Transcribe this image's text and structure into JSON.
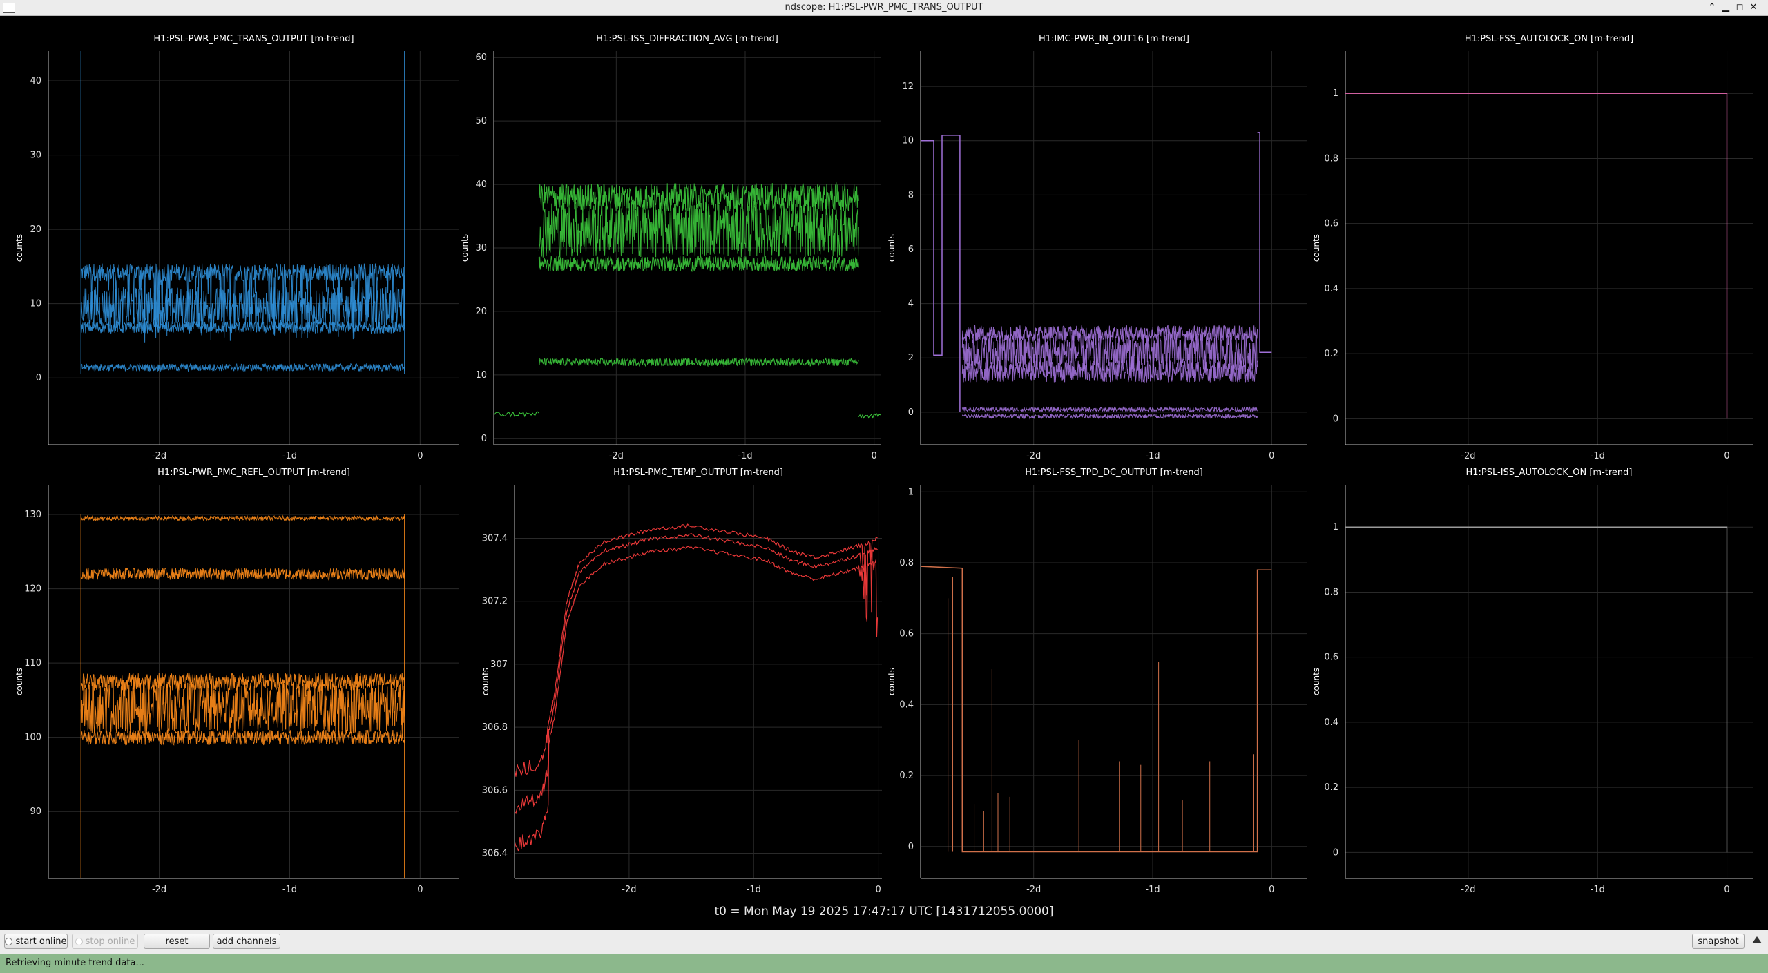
{
  "window": {
    "title": "ndscope: H1:PSL-PWR_PMC_TRANS_OUTPUT"
  },
  "colors": {
    "blue": "#2f8fd8",
    "green": "#3cc83c",
    "purple": "#a070d8",
    "pink": "#d060a0",
    "orange": "#ff8c1a",
    "red": "#e83838",
    "brown": "#d0704a",
    "gray": "#9a9a9a"
  },
  "t0_label": "t0 = Mon May 19 2025 17:47:17 UTC [1431712055.0000]",
  "toolbar": {
    "start_online": "start online",
    "stop_online": "stop online",
    "reset": "reset",
    "add_channels": "add channels",
    "snapshot": "snapshot"
  },
  "status": {
    "message": "Retrieving minute trend data..."
  },
  "chart_data": [
    {
      "type": "line",
      "title": "H1:PSL-PWR_PMC_TRANS_OUTPUT [m-trend]",
      "ylabel": "counts",
      "color": "blue",
      "xlim": [
        -2.85,
        0.3
      ],
      "ylim": [
        -9,
        44
      ],
      "x_ticks": [
        {
          "v": -2,
          "label": "-2d"
        },
        {
          "v": -1,
          "label": "-1d"
        },
        {
          "v": 0,
          "label": "0"
        }
      ],
      "y_ticks": [
        0,
        10,
        20,
        30,
        40
      ],
      "data_start": -2.6,
      "data_end": -0.12,
      "series": [
        {
          "name": "max",
          "level": 14.2,
          "noise": 1.2,
          "dips": 9.5,
          "dip_prob": 0.12
        },
        {
          "name": "mean",
          "level": 9.5,
          "noise": 2.8
        },
        {
          "name": "min",
          "level": 6.8,
          "noise": 0.8
        },
        {
          "name": "min-low",
          "level": 1.4,
          "noise": 0.5
        }
      ],
      "edge_spike": {
        "low": 0.5,
        "high": 45
      }
    },
    {
      "type": "line",
      "title": "H1:PSL-ISS_DIFFRACTION_AVG [m-trend]",
      "ylabel": "counts",
      "color": "green",
      "xlim": [
        -2.95,
        0.05
      ],
      "ylim": [
        -1,
        61
      ],
      "x_ticks": [
        {
          "v": -2,
          "label": "-2d"
        },
        {
          "v": -1,
          "label": "-1d"
        },
        {
          "v": 0,
          "label": "0"
        }
      ],
      "y_ticks": [
        0,
        10,
        20,
        30,
        40,
        50,
        60
      ],
      "data_start": -2.6,
      "data_end": -0.12,
      "pre_level": 3.8,
      "post_level": 3.5,
      "series": [
        {
          "name": "max",
          "level": 38,
          "noise": 2.2
        },
        {
          "name": "mean",
          "level": 33,
          "noise": 4.5
        },
        {
          "name": "min",
          "level": 27.5,
          "noise": 1.2
        },
        {
          "name": "low",
          "level": 12,
          "noise": 0.6
        }
      ]
    },
    {
      "type": "line",
      "title": "H1:IMC-PWR_IN_OUT16 [m-trend]",
      "ylabel": "counts",
      "color": "purple",
      "xlim": [
        -2.95,
        0.3
      ],
      "ylim": [
        -1.2,
        13.3
      ],
      "x_ticks": [
        {
          "v": -2,
          "label": "-2d"
        },
        {
          "v": -1,
          "label": "-1d"
        },
        {
          "v": 0,
          "label": "0"
        }
      ],
      "y_ticks": [
        0,
        2,
        4,
        6,
        8,
        10,
        12
      ],
      "data_start": -2.6,
      "data_end": -0.12,
      "steps": [
        [
          -2.95,
          10
        ],
        [
          -2.84,
          10
        ],
        [
          -2.84,
          2.1
        ],
        [
          -2.77,
          2.1
        ],
        [
          -2.77,
          10.2
        ],
        [
          -2.62,
          10.2
        ],
        [
          -2.62,
          0
        ]
      ],
      "post_steps": [
        [
          -0.12,
          10.3
        ],
        [
          -0.1,
          10.3
        ],
        [
          -0.1,
          2.2
        ],
        [
          0.0,
          2.2
        ]
      ],
      "series": [
        {
          "name": "max",
          "level": 2.9,
          "noise": 0.3
        },
        {
          "name": "mean",
          "level": 2.2,
          "noise": 0.7
        },
        {
          "name": "min",
          "level": 1.5,
          "noise": 0.4
        },
        {
          "name": "low",
          "level": 0.1,
          "noise": 0.08
        },
        {
          "name": "lowmin",
          "level": -0.15,
          "noise": 0.08
        }
      ]
    },
    {
      "type": "line",
      "title": "H1:PSL-FSS_AUTOLOCK_ON [m-trend]",
      "ylabel": "counts",
      "color": "pink",
      "xlim": [
        -2.95,
        0.2
      ],
      "ylim": [
        -0.08,
        1.13
      ],
      "x_ticks": [
        {
          "v": -2,
          "label": "-2d"
        },
        {
          "v": -1,
          "label": "-1d"
        },
        {
          "v": 0,
          "label": "0"
        }
      ],
      "y_ticks": [
        {
          "v": 0,
          "label": "0"
        },
        {
          "v": 0.2,
          "label": "0.2"
        },
        {
          "v": 0.4,
          "label": "0.4"
        },
        {
          "v": 0.6,
          "label": "0.6"
        },
        {
          "v": 0.8,
          "label": "0.8"
        },
        {
          "v": 1,
          "label": "1"
        }
      ],
      "steps": [
        [
          -2.95,
          1
        ],
        [
          0.0,
          1
        ],
        [
          0.0,
          0
        ]
      ]
    },
    {
      "type": "line",
      "title": "H1:PSL-PWR_PMC_REFL_OUTPUT [m-trend]",
      "ylabel": "counts",
      "color": "orange",
      "xlim": [
        -2.85,
        0.3
      ],
      "ylim": [
        81,
        134
      ],
      "x_ticks": [
        {
          "v": -2,
          "label": "-2d"
        },
        {
          "v": -1,
          "label": "-1d"
        },
        {
          "v": 0,
          "label": "0"
        }
      ],
      "y_ticks": [
        90,
        100,
        110,
        120,
        130
      ],
      "data_start": -2.6,
      "data_end": -0.12,
      "series": [
        {
          "name": "max",
          "level": 129.5,
          "noise": 0.3
        },
        {
          "name": "upper",
          "level": 122,
          "noise": 0.8
        },
        {
          "name": "mean-hi",
          "level": 107.5,
          "noise": 1.2
        },
        {
          "name": "mean",
          "level": 104,
          "noise": 3.5
        },
        {
          "name": "min",
          "level": 100,
          "noise": 1.0
        }
      ],
      "edge_spike": {
        "low": 81,
        "high": 130
      }
    },
    {
      "type": "line",
      "title": "H1:PSL-PMC_TEMP_OUTPUT [m-trend]",
      "ylabel": "counts",
      "color": "red",
      "xlim": [
        -2.92,
        0.03
      ],
      "ylim": [
        306.32,
        307.57
      ],
      "x_ticks": [
        {
          "v": -2,
          "label": "-2d"
        },
        {
          "v": -1,
          "label": "-1d"
        },
        {
          "v": 0,
          "label": "0"
        }
      ],
      "y_ticks": [
        {
          "v": 306.4,
          "label": "306.4"
        },
        {
          "v": 306.6,
          "label": "306.6"
        },
        {
          "v": 306.8,
          "label": "306.8"
        },
        {
          "v": 307,
          "label": "307"
        },
        {
          "v": 307.2,
          "label": "307.2"
        },
        {
          "v": 307.4,
          "label": "307.4"
        }
      ],
      "temp_curve": [
        [
          -2.92,
          306.68
        ],
        [
          -2.7,
          306.72
        ],
        [
          -2.6,
          306.9
        ],
        [
          -2.5,
          307.2
        ],
        [
          -2.4,
          307.32
        ],
        [
          -2.2,
          307.39
        ],
        [
          -2.0,
          307.41
        ],
        [
          -1.8,
          307.43
        ],
        [
          -1.5,
          307.44
        ],
        [
          -1.2,
          307.42
        ],
        [
          -0.9,
          307.4
        ],
        [
          -0.7,
          307.36
        ],
        [
          -0.5,
          307.34
        ],
        [
          -0.3,
          307.36
        ],
        [
          -0.12,
          307.38
        ],
        [
          0.0,
          307.4
        ]
      ]
    },
    {
      "type": "line",
      "title": "H1:PSL-FSS_TPD_DC_OUTPUT [m-trend]",
      "ylabel": "counts",
      "color": "brown",
      "xlim": [
        -2.95,
        0.3
      ],
      "ylim": [
        -0.09,
        1.02
      ],
      "x_ticks": [
        {
          "v": -2,
          "label": "-2d"
        },
        {
          "v": -1,
          "label": "-1d"
        },
        {
          "v": 0,
          "label": "0"
        }
      ],
      "y_ticks": [
        {
          "v": 0,
          "label": "0"
        },
        {
          "v": 0.2,
          "label": "0.2"
        },
        {
          "v": 0.4,
          "label": "0.4"
        },
        {
          "v": 0.6,
          "label": "0.6"
        },
        {
          "v": 0.8,
          "label": "0.8"
        },
        {
          "v": 1,
          "label": "1"
        }
      ],
      "steps": [
        [
          -2.95,
          0.79
        ],
        [
          -2.6,
          0.785
        ],
        [
          -2.6,
          -0.015
        ],
        [
          -0.12,
          -0.015
        ],
        [
          -0.12,
          0.78
        ],
        [
          0.0,
          0.78
        ]
      ],
      "spikes": [
        [
          -2.72,
          0.7
        ],
        [
          -2.68,
          0.76
        ],
        [
          -2.5,
          0.12
        ],
        [
          -2.42,
          0.1
        ],
        [
          -2.35,
          0.5
        ],
        [
          -2.3,
          0.15
        ],
        [
          -2.2,
          0.14
        ],
        [
          -1.62,
          0.3
        ],
        [
          -1.28,
          0.24
        ],
        [
          -1.1,
          0.23
        ],
        [
          -0.95,
          0.52
        ],
        [
          -0.75,
          0.13
        ],
        [
          -0.52,
          0.24
        ],
        [
          -0.15,
          0.26
        ]
      ]
    },
    {
      "type": "line",
      "title": "H1:PSL-ISS_AUTOLOCK_ON [m-trend]",
      "ylabel": "counts",
      "color": "gray",
      "xlim": [
        -2.95,
        0.2
      ],
      "ylim": [
        -0.08,
        1.13
      ],
      "x_ticks": [
        {
          "v": -2,
          "label": "-2d"
        },
        {
          "v": -1,
          "label": "-1d"
        },
        {
          "v": 0,
          "label": "0"
        }
      ],
      "y_ticks": [
        {
          "v": 0,
          "label": "0"
        },
        {
          "v": 0.2,
          "label": "0.2"
        },
        {
          "v": 0.4,
          "label": "0.4"
        },
        {
          "v": 0.6,
          "label": "0.6"
        },
        {
          "v": 0.8,
          "label": "0.8"
        },
        {
          "v": 1,
          "label": "1"
        }
      ],
      "steps": [
        [
          -2.95,
          1
        ],
        [
          0.0,
          1
        ],
        [
          0.0,
          0
        ]
      ]
    }
  ]
}
